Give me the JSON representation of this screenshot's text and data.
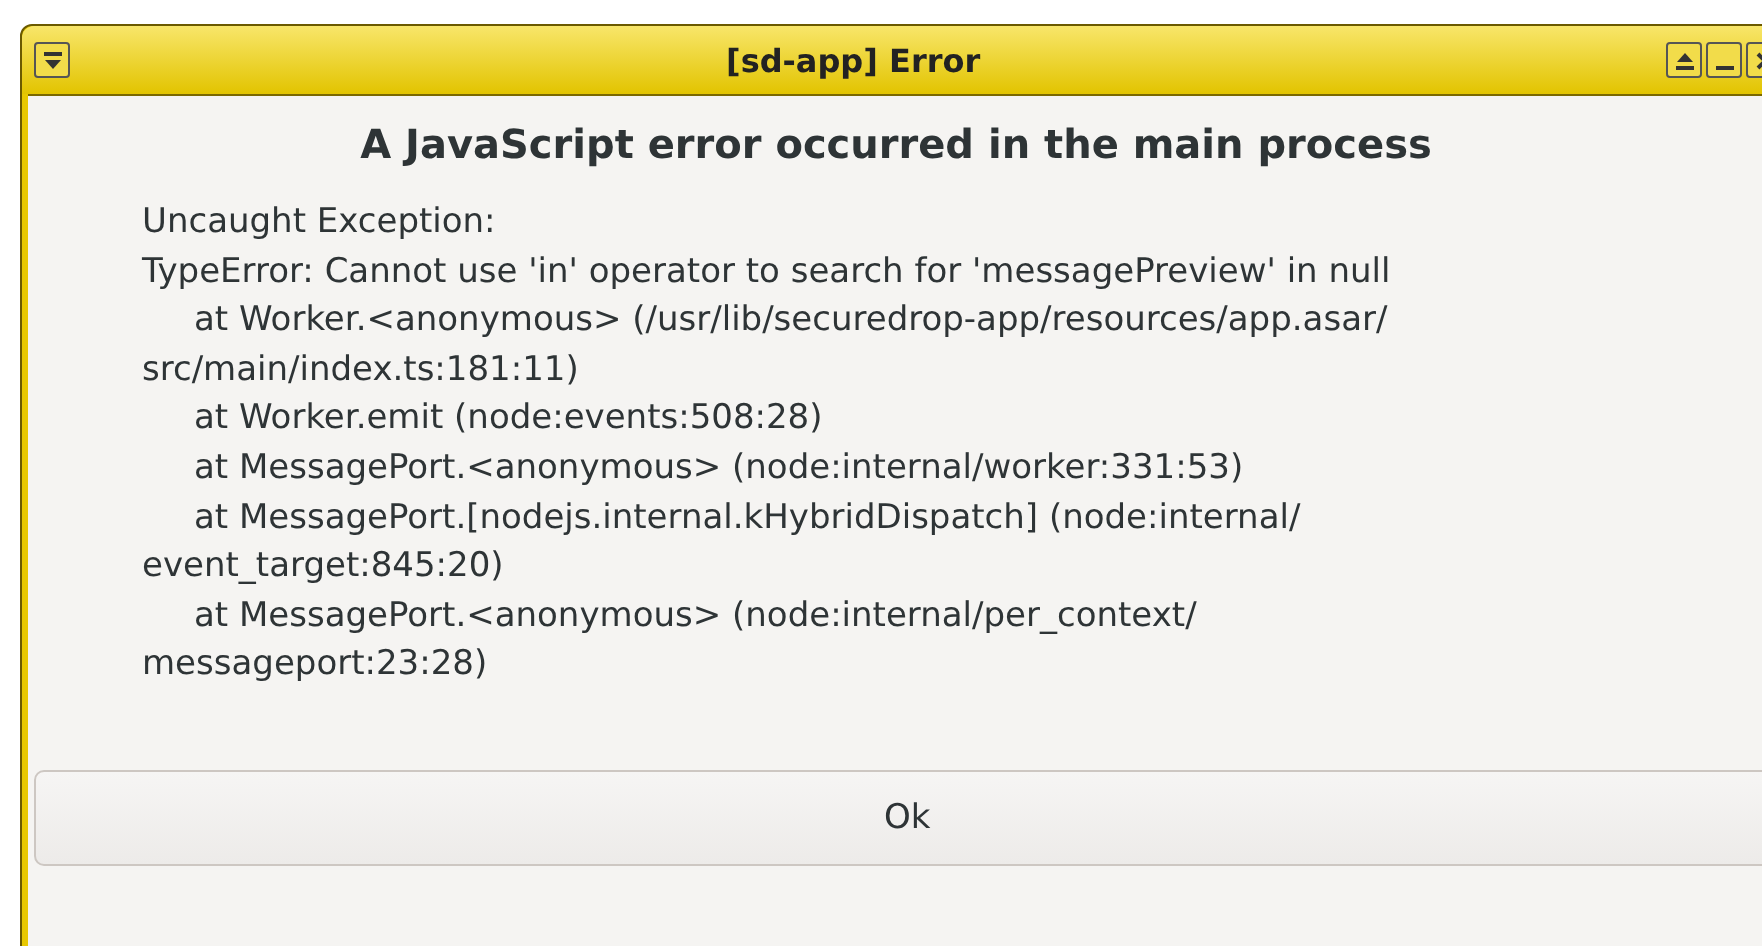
{
  "window": {
    "title": "[sd-app] Error"
  },
  "heading": "A JavaScript error occurred in the main process",
  "message_lines": [
    {
      "text": "Uncaught Exception:",
      "indented": false
    },
    {
      "text": "TypeError: Cannot use 'in' operator to search for 'messagePreview' in null",
      "indented": false
    },
    {
      "text": "at Worker.<anonymous> (/usr/lib/securedrop-app/resources/app.asar/",
      "indented": true
    },
    {
      "text": "src/main/index.ts:181:11)",
      "indented": false
    },
    {
      "text": "at Worker.emit (node:events:508:28)",
      "indented": true
    },
    {
      "text": "at MessagePort.<anonymous> (node:internal/worker:331:53)",
      "indented": true
    },
    {
      "text": "at MessagePort.[nodejs.internal.kHybridDispatch] (node:internal/",
      "indented": true
    },
    {
      "text": "event_target:845:20)",
      "indented": false
    },
    {
      "text": "at MessagePort.<anonymous> (node:internal/per_context/",
      "indented": true
    },
    {
      "text": "messageport:23:28)",
      "indented": false
    }
  ],
  "buttons": [
    "Ok"
  ]
}
